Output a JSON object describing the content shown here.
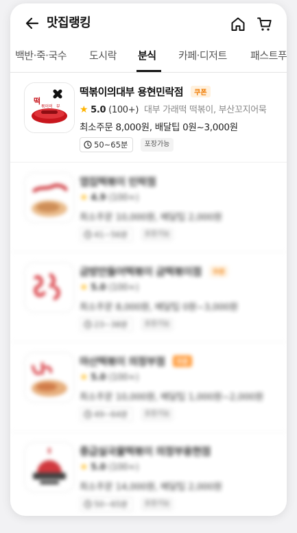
{
  "header": {
    "title": "맛집랭킹",
    "icons": [
      "back-arrow-icon",
      "home-icon",
      "cart-icon"
    ]
  },
  "tabs": [
    {
      "label": "백반·죽·국수",
      "active": false
    },
    {
      "label": "도시락",
      "active": false
    },
    {
      "label": "분식",
      "active": true
    },
    {
      "label": "카페·디저트",
      "active": false
    },
    {
      "label": "패스트푸드",
      "active": false
    }
  ],
  "restaurants": [
    {
      "name": "떡볶이의대부 용현민락점",
      "coupon": "쿠폰",
      "rating": "5.0",
      "reviews": "(100+)",
      "menu": "대부 가래떡 떡볶이, 부산꼬지어묵",
      "fees": "최소주문 8,000원, 배달팁 0원~3,000원",
      "time": "50~65분",
      "tag": "포장가능",
      "logo_text": "떡볶이의대부",
      "blurred": false
    },
    {
      "name": "엽집떡볶이 민락점",
      "coupon": "",
      "rating": "4.9",
      "reviews": "(100+)",
      "menu": "",
      "fees": "최소주문 10,000원, 배달팁 2,000원",
      "time": "41~56분",
      "tag": "포장가능",
      "blurred": true
    },
    {
      "name": "금방만들어떡볶이 금떡볶이점",
      "coupon": "쿠폰",
      "rating": "5.0",
      "reviews": "(100+)",
      "menu": "",
      "fees": "최소주문 8,000원, 배달팁 0원~3,000원",
      "time": "23~38분",
      "tag": "포장가능",
      "blurred": true
    },
    {
      "name": "마산떡볶이 의정부점",
      "coupon": "쿠폰",
      "rating": "5.0",
      "reviews": "(100+)",
      "menu": "",
      "fees": "최소주문 10,000원, 배달팁 1,000원~2,000원",
      "time": "49~64분",
      "tag": "포장가능",
      "blurred": true
    },
    {
      "name": "중급실국물떡볶이 의정부용현점",
      "coupon": "",
      "rating": "5.0",
      "reviews": "(100+)",
      "menu": "",
      "fees": "최소주문 14,000원, 배달팁 2,000원",
      "time": "50~65분",
      "tag": "포장가능",
      "blurred": true
    }
  ]
}
